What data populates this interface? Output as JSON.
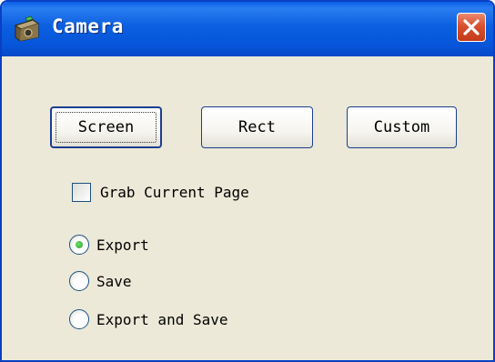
{
  "window": {
    "title": "Camera",
    "app_icon": "camera-icon",
    "close_icon": "close-icon",
    "colors": {
      "titlebar": "#0b5fe0",
      "client_bg": "#ece9d8",
      "close_button": "#d8512e",
      "radio_selected": "#2aa82a"
    }
  },
  "buttons": {
    "screen": "Screen",
    "rect": "Rect",
    "custom": "Custom"
  },
  "options": {
    "grab_current_page": {
      "label": "Grab Current Page",
      "checked": false
    }
  },
  "mode": {
    "selected": "Export",
    "items": [
      {
        "label": "Export",
        "selected": true
      },
      {
        "label": "Save",
        "selected": false
      },
      {
        "label": "Export and Save",
        "selected": false
      }
    ]
  }
}
